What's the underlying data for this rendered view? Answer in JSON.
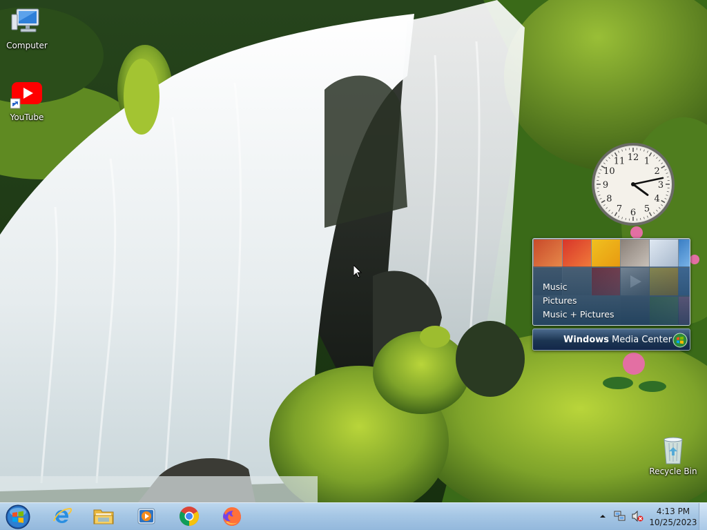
{
  "desktop": {
    "icons": [
      {
        "label": "Computer",
        "icon": "computer-icon"
      },
      {
        "label": "YouTube",
        "icon": "youtube-icon"
      },
      {
        "label": "Recycle Bin",
        "icon": "recycle-bin-icon"
      }
    ]
  },
  "clock_gadget": {
    "numerals": [
      "12",
      "1",
      "2",
      "3",
      "4",
      "5",
      "6",
      "7",
      "8",
      "9",
      "10",
      "11"
    ],
    "time": {
      "hour": 4,
      "minute": 13
    }
  },
  "media_center_gadget": {
    "menu": [
      "Music",
      "Pictures",
      "Music + Pictures"
    ],
    "title_bold": "Windows",
    "title_rest": " Media Center"
  },
  "taskbar": {
    "start": "start-orb-icon",
    "pinned": [
      {
        "name": "internet-explorer",
        "icon": "ie-icon"
      },
      {
        "name": "file-explorer",
        "icon": "folder-icon"
      },
      {
        "name": "media-player",
        "icon": "media-player-icon"
      },
      {
        "name": "chrome",
        "icon": "chrome-icon"
      },
      {
        "name": "firefox",
        "icon": "firefox-icon"
      }
    ],
    "tray": {
      "time": "4:13 PM",
      "date": "10/25/2023",
      "icons": [
        "show-hidden-icons-arrow",
        "network-icon",
        "volume-muted-icon"
      ]
    }
  },
  "colors": {
    "taskbar": "#a6c7e5",
    "wmc_bar": "#1c3552",
    "youtube_red": "#ff0000"
  }
}
